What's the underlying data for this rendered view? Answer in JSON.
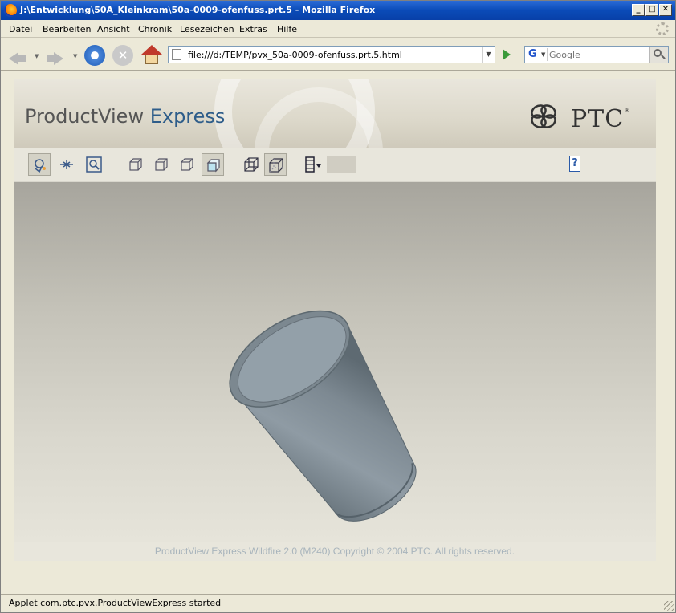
{
  "window": {
    "title": "J:\\Entwicklung\\50A_Kleinkram\\50a-0009-ofenfuss.prt.5 - Mozilla Firefox",
    "buttons": {
      "minimize": "_",
      "maximize": "□",
      "close": "✕"
    }
  },
  "menubar": {
    "items": [
      "Datei",
      "Bearbeiten",
      "Ansicht",
      "Chronik",
      "Lesezeichen",
      "Extras",
      "Hilfe"
    ]
  },
  "navbar": {
    "url": "file:///d:/TEMP/pvx_50a-0009-ofenfuss.prt.5.html",
    "search_engine_letter": "G",
    "search_placeholder": "Google"
  },
  "viewer": {
    "brand_main": "ProductView",
    "brand_accent": " Express",
    "vendor_logo": "PTC",
    "vendor_reg": "®",
    "help_label": "?",
    "footer": "ProductView Express Wildfire 2.0 (M240) Copyright © 2004 PTC.  All rights reserved."
  },
  "statusbar": {
    "text": "Applet com.ptc.pvx.ProductViewExpress started"
  },
  "colors": {
    "titlebar": "#0a4bb8",
    "brand_accent": "#2e5d8a",
    "model_fill": "#8a96a0"
  }
}
